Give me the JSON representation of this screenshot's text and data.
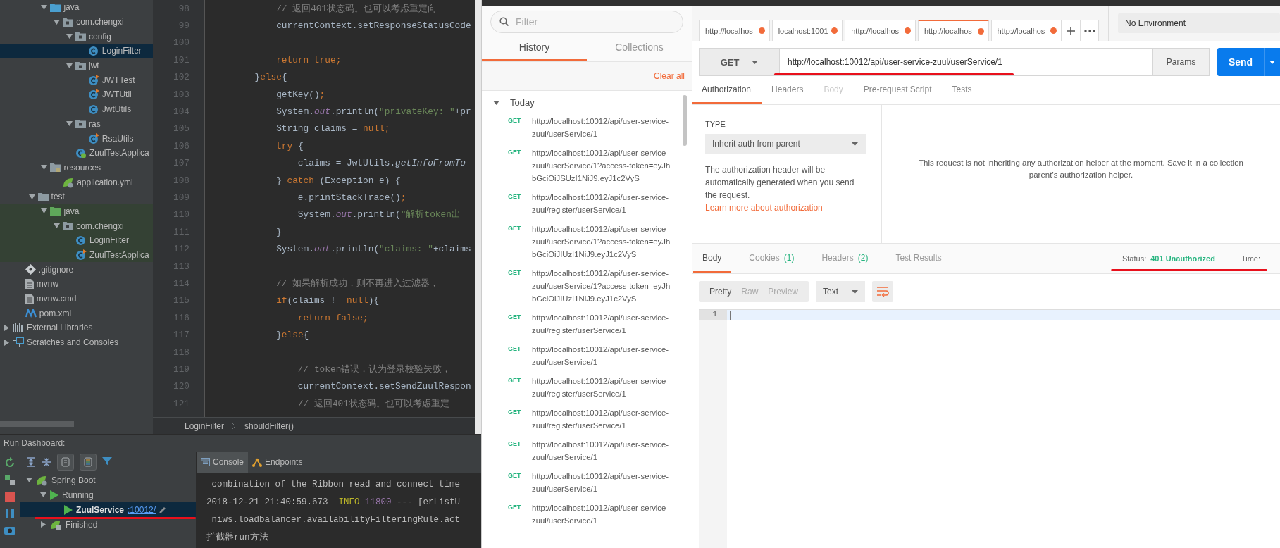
{
  "project_tree": {
    "items": [
      {
        "children": [
          {
            "children": [
              {
                "children": [
                  {
                    "label": "java",
                    "kind": "source-folder",
                    "expanded": true,
                    "selected": false,
                    "children": [
                      {
                        "label": "com.chengxi",
                        "kind": "package",
                        "expanded": true,
                        "selected": false,
                        "children": [
                          {
                            "label": "config",
                            "kind": "package",
                            "expanded": true,
                            "selected": false,
                            "children": [
                              {
                                "label": "LoginFilter",
                                "kind": "class",
                                "selected": true
                              }
                            ]
                          },
                          {
                            "label": "jwt",
                            "kind": "package",
                            "expanded": true,
                            "selected": false,
                            "children": [
                              {
                                "label": "JWTTest",
                                "kind": "runnable-class",
                                "selected": false
                              },
                              {
                                "label": "JWTUtil",
                                "kind": "runnable-class",
                                "selected": false
                              },
                              {
                                "label": "JwtUtils",
                                "kind": "class",
                                "selected": false
                              }
                            ]
                          },
                          {
                            "label": "ras",
                            "kind": "package",
                            "expanded": true,
                            "selected": false,
                            "children": [
                              {
                                "label": "RsaUtils",
                                "kind": "runnable-class",
                                "selected": false
                              }
                            ]
                          },
                          {
                            "label": "ZuulTestApplica",
                            "kind": "spring-class",
                            "selected": false
                          }
                        ]
                      }
                    ]
                  },
                  {
                    "label": "resources",
                    "kind": "resources-folder",
                    "expanded": true,
                    "selected": false,
                    "children": [
                      {
                        "label": "application.yml",
                        "kind": "spring-config",
                        "selected": false
                      }
                    ]
                  }
                ]
              },
              {
                "label": "test",
                "kind": "folder",
                "expanded": true,
                "selected": false,
                "children": [
                  {
                    "label": "java",
                    "kind": "test-source-folder",
                    "expanded": true,
                    "selected": false,
                    "children": [
                      {
                        "label": "com.chengxi",
                        "kind": "package",
                        "expanded": true,
                        "selected": false,
                        "children": [
                          {
                            "label": "LoginFilter",
                            "kind": "class",
                            "selected": false
                          },
                          {
                            "label": "ZuulTestApplica",
                            "kind": "runnable-class",
                            "selected": false
                          }
                        ]
                      }
                    ]
                  }
                ]
              }
            ]
          },
          {
            "label": ".gitignore",
            "kind": "git-file",
            "selected": false
          },
          {
            "label": "mvnw",
            "kind": "text-file",
            "selected": false
          },
          {
            "label": "mvnw.cmd",
            "kind": "text-file",
            "selected": false
          },
          {
            "label": "pom.xml",
            "kind": "maven-file",
            "selected": false
          }
        ]
      },
      {
        "label": "External Libraries",
        "kind": "libraries",
        "expanded": false,
        "selected": false
      },
      {
        "label": "Scratches and Consoles",
        "kind": "scratches",
        "expanded": false,
        "selected": false
      }
    ]
  },
  "editor": {
    "lines": [
      {
        "number": "98",
        "tokens": [
          {
            "text": "            // 返回401状态码。也可以考虑重定向",
            "kind": "comment"
          }
        ]
      },
      {
        "number": "99",
        "tokens": [
          {
            "text": "            currentContext.setResponseStatusCode",
            "kind": "plain"
          }
        ]
      },
      {
        "number": "100"
      },
      {
        "number": "101",
        "tokens": [
          {
            "text": "            return true;",
            "kind": "keyword"
          }
        ]
      },
      {
        "number": "102",
        "tokens": [
          {
            "text": "        }",
            "kind": "plain"
          },
          {
            "text": "else",
            "kind": "keyword"
          },
          {
            "text": "{",
            "kind": "plain"
          }
        ]
      },
      {
        "number": "103",
        "tokens": [
          {
            "text": "            getKey()",
            "kind": "plain"
          },
          {
            "text": ";",
            "kind": "keyword"
          }
        ]
      },
      {
        "number": "104",
        "tokens": [
          {
            "text": "            System.",
            "kind": "plain"
          },
          {
            "text": "out",
            "kind": "static"
          },
          {
            "text": ".println(",
            "kind": "plain"
          },
          {
            "text": "\"privateKey: \"",
            "kind": "string"
          },
          {
            "text": "+pr",
            "kind": "plain"
          }
        ]
      },
      {
        "number": "105",
        "tokens": [
          {
            "text": "            String claims = ",
            "kind": "plain"
          },
          {
            "text": "null;",
            "kind": "keyword"
          }
        ]
      },
      {
        "number": "106",
        "tokens": [
          {
            "text": "            try",
            "kind": "keyword"
          },
          {
            "text": " {",
            "kind": "plain"
          }
        ]
      },
      {
        "number": "107",
        "tokens": [
          {
            "text": "                claims = JwtUtils.",
            "kind": "plain"
          },
          {
            "text": "getInfoFromTo",
            "kind": "italic"
          }
        ]
      },
      {
        "number": "108",
        "tokens": [
          {
            "text": "            } ",
            "kind": "plain"
          },
          {
            "text": "catch",
            "kind": "keyword"
          },
          {
            "text": " (Exception e) {",
            "kind": "plain"
          }
        ]
      },
      {
        "number": "109",
        "tokens": [
          {
            "text": "                e.printStackTrace()",
            "kind": "plain"
          },
          {
            "text": ";",
            "kind": "keyword"
          }
        ]
      },
      {
        "number": "110",
        "tokens": [
          {
            "text": "                System.",
            "kind": "plain"
          },
          {
            "text": "out",
            "kind": "static"
          },
          {
            "text": ".println(",
            "kind": "plain"
          },
          {
            "text": "\"解析token出",
            "kind": "string"
          }
        ]
      },
      {
        "number": "111",
        "tokens": [
          {
            "text": "            }",
            "kind": "plain"
          }
        ]
      },
      {
        "number": "112",
        "tokens": [
          {
            "text": "            System.",
            "kind": "plain"
          },
          {
            "text": "out",
            "kind": "static"
          },
          {
            "text": ".println(",
            "kind": "plain"
          },
          {
            "text": "\"claims: \"",
            "kind": "string"
          },
          {
            "text": "+claims",
            "kind": "plain"
          }
        ]
      },
      {
        "number": "113"
      },
      {
        "number": "114",
        "tokens": [
          {
            "text": "            // 如果解析成功，则不再进入过滤器，",
            "kind": "comment"
          }
        ]
      },
      {
        "number": "115",
        "tokens": [
          {
            "text": "            if",
            "kind": "keyword"
          },
          {
            "text": "(claims != ",
            "kind": "plain"
          },
          {
            "text": "null",
            "kind": "keyword"
          },
          {
            "text": "){",
            "kind": "plain"
          }
        ]
      },
      {
        "number": "116",
        "tokens": [
          {
            "text": "                return false;",
            "kind": "keyword"
          }
        ]
      },
      {
        "number": "117",
        "tokens": [
          {
            "text": "            }",
            "kind": "plain"
          },
          {
            "text": "else",
            "kind": "keyword"
          },
          {
            "text": "{",
            "kind": "plain"
          }
        ]
      },
      {
        "number": "118"
      },
      {
        "number": "119",
        "tokens": [
          {
            "text": "                // token错误，认为登录校验失败，",
            "kind": "comment"
          }
        ]
      },
      {
        "number": "120",
        "tokens": [
          {
            "text": "                currentContext.setSendZuulRespon",
            "kind": "plain"
          }
        ]
      },
      {
        "number": "121",
        "tokens": [
          {
            "text": "                // 返回401状态码。也可以考虑重定",
            "kind": "comment"
          }
        ]
      }
    ],
    "breadcrumbs": [
      "LoginFilter",
      "shouldFilter()"
    ]
  },
  "run_dashboard": {
    "title": "Run Dashboard:",
    "tree": [
      {
        "label": "Spring Boot",
        "kind": "spring-group",
        "expanded": true,
        "selected": false,
        "children": [
          {
            "label": "Running",
            "kind": "running",
            "expanded": true,
            "selected": false,
            "children": [
              {
                "label": "ZuulService",
                "port": ":10012/",
                "kind": "service",
                "selected": true
              }
            ]
          },
          {
            "label": "Finished",
            "kind": "finished",
            "expanded": false,
            "selected": false
          }
        ]
      }
    ],
    "console_tabs": [
      {
        "label": "Console",
        "kind": "console",
        "selected": true
      },
      {
        "label": "Endpoints",
        "kind": "endpoints",
        "selected": false
      }
    ],
    "console_lines": [
      [
        {
          "text": " combination of the Ribbon read and connect time",
          "kind": "plain"
        }
      ],
      [
        {
          "text": "2018-12-21 21:40:59.673  ",
          "kind": "plain"
        },
        {
          "text": "INFO",
          "kind": "info"
        },
        {
          "text": " 11800",
          "kind": "pid"
        },
        {
          "text": " --- [erListU",
          "kind": "plain"
        }
      ],
      [
        {
          "text": " niws.loadbalancer.availabilityFilteringRule.act",
          "kind": "plain"
        }
      ],
      [
        {
          "text": "拦截器run方法",
          "kind": "plain"
        }
      ]
    ]
  },
  "postman": {
    "filter": {
      "placeholder": "Filter"
    },
    "sidebar_tabs": [
      {
        "label": "History",
        "selected": true
      },
      {
        "label": "Collections",
        "selected": false
      }
    ],
    "clear_all": "Clear all",
    "history_group": {
      "label": "Today",
      "expanded": true,
      "items": [
        {
          "method": "GET",
          "url": "http://localhost:10012/api/user-service-zuul/userService/1"
        },
        {
          "method": "GET",
          "url": "http://localhost:10012/api/user-service-zuul/userService/1?access-token=eyJhbGciOiJSUzI1NiJ9.eyJ1c2VyS"
        },
        {
          "method": "GET",
          "url": "http://localhost:10012/api/user-service-zuul/register/userService/1"
        },
        {
          "method": "GET",
          "url": "http://localhost:10012/api/user-service-zuul/userService/1?access-token=eyJhbGciOiJIUzI1NiJ9.eyJ1c2VyS"
        },
        {
          "method": "GET",
          "url": "http://localhost:10012/api/user-service-zuul/userService/1?access-token=eyJhbGciOiJIUzI1NiJ9.eyJ1c2VyS"
        },
        {
          "method": "GET",
          "url": "http://localhost:10012/api/user-service-zuul/register/userService/1"
        },
        {
          "method": "GET",
          "url": "http://localhost:10012/api/user-service-zuul/userService/1"
        },
        {
          "method": "GET",
          "url": "http://localhost:10012/api/user-service-zuul/register/userService/1"
        },
        {
          "method": "GET",
          "url": "http://localhost:10012/api/user-service-zuul/register/userService/1"
        },
        {
          "method": "GET",
          "url": "http://localhost:10012/api/user-service-zuul/userService/1"
        },
        {
          "method": "GET",
          "url": "http://localhost:10012/api/user-service-zuul/userService/1"
        },
        {
          "method": "GET",
          "url": "http://localhost:10012/api/user-service-zuul/userService/1"
        }
      ]
    },
    "request_tabs": [
      {
        "label": "http://localhos",
        "unsaved": true,
        "selected": false
      },
      {
        "label": "localhost:1001",
        "unsaved": true,
        "selected": false
      },
      {
        "label": "http://localhos",
        "unsaved": true,
        "selected": false
      },
      {
        "label": "http://localhos",
        "unsaved": true,
        "selected": true
      },
      {
        "label": "http://localhos",
        "unsaved": true,
        "selected": false
      }
    ],
    "environment": "No Environment",
    "request": {
      "method": "GET",
      "url": "http://localhost:10012/api/user-service-zuul/userService/1",
      "params_label": "Params",
      "send_label": "Send"
    },
    "section_tabs": [
      {
        "label": "Authorization",
        "selected": true,
        "disabled": false
      },
      {
        "label": "Headers",
        "selected": false,
        "disabled": false
      },
      {
        "label": "Body",
        "selected": false,
        "disabled": true
      },
      {
        "label": "Pre-request Script",
        "selected": false,
        "disabled": false
      },
      {
        "label": "Tests",
        "selected": false,
        "disabled": false
      }
    ],
    "auth": {
      "type_label": "TYPE",
      "type_value": "Inherit auth from parent",
      "description": "The authorization header will be automatically generated when you send the request.",
      "link": "Learn more about authorization",
      "message_lines": [
        "This request is not inheriting any authorization helper at the moment. Save it in a collection",
        "parent's authorization helper."
      ]
    },
    "response": {
      "tabs": [
        {
          "label": "Body",
          "selected": true
        },
        {
          "label": "Cookies",
          "count": "(1)",
          "selected": false
        },
        {
          "label": "Headers",
          "count": "(2)",
          "selected": false
        },
        {
          "label": "Test Results",
          "selected": false
        }
      ],
      "status_label": "Status:",
      "status_value": "401 Unauthorized",
      "time_label": "Time:",
      "view_modes": [
        {
          "label": "Pretty",
          "selected": true
        },
        {
          "label": "Raw",
          "selected": false
        },
        {
          "label": "Preview",
          "selected": false
        }
      ],
      "format": "Text",
      "wrap_on": true,
      "line_numbers": [
        "1"
      ]
    }
  }
}
